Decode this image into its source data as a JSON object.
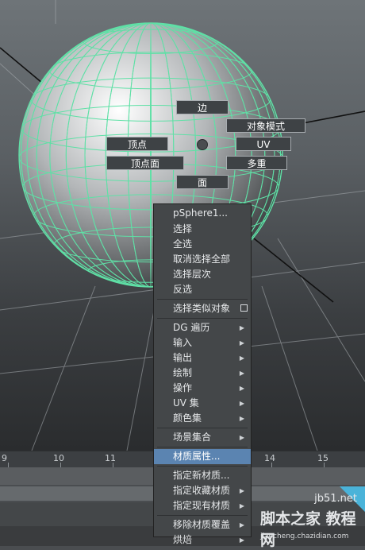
{
  "marking_menu": {
    "edge": "边",
    "object_mode": "对象模式",
    "vertex": "顶点",
    "uv": "UV",
    "vertex_face": "顶点面",
    "multi": "多重",
    "face": "面"
  },
  "context_menu": {
    "title": "pSphere1...",
    "items": [
      {
        "label": "选择"
      },
      {
        "label": "全选"
      },
      {
        "label": "取消选择全部"
      },
      {
        "label": "选择层次"
      },
      {
        "label": "反选"
      },
      {
        "label": "选择类似对象",
        "checkbox": true
      },
      {
        "label": "DG 遍历",
        "submenu": true
      },
      {
        "label": "输入",
        "submenu": true
      },
      {
        "label": "输出",
        "submenu": true
      },
      {
        "label": "绘制",
        "submenu": true
      },
      {
        "label": "操作",
        "submenu": true
      },
      {
        "label": "UV 集",
        "submenu": true
      },
      {
        "label": "颜色集",
        "submenu": true
      },
      {
        "label": "场景集合",
        "submenu": true
      },
      {
        "label": "材质属性...",
        "highlighted": true
      },
      {
        "label": "指定新材质..."
      },
      {
        "label": "指定收藏材质",
        "submenu": true
      },
      {
        "label": "指定现有材质",
        "submenu": true
      },
      {
        "label": "移除材质覆盖",
        "submenu": true
      },
      {
        "label": "烘焙",
        "submenu": true
      }
    ]
  },
  "timeline": {
    "ticks": [
      "9",
      "10",
      "11",
      "14",
      "15"
    ]
  },
  "watermark": {
    "site": "jb51.net",
    "brand": "脚本之家 教程网",
    "url": "jiaocheng.chazidian.com"
  },
  "colors": {
    "wireframe": "#5fe0a6",
    "menu_highlight": "#5b84b1",
    "menu_bg": "#444749"
  }
}
